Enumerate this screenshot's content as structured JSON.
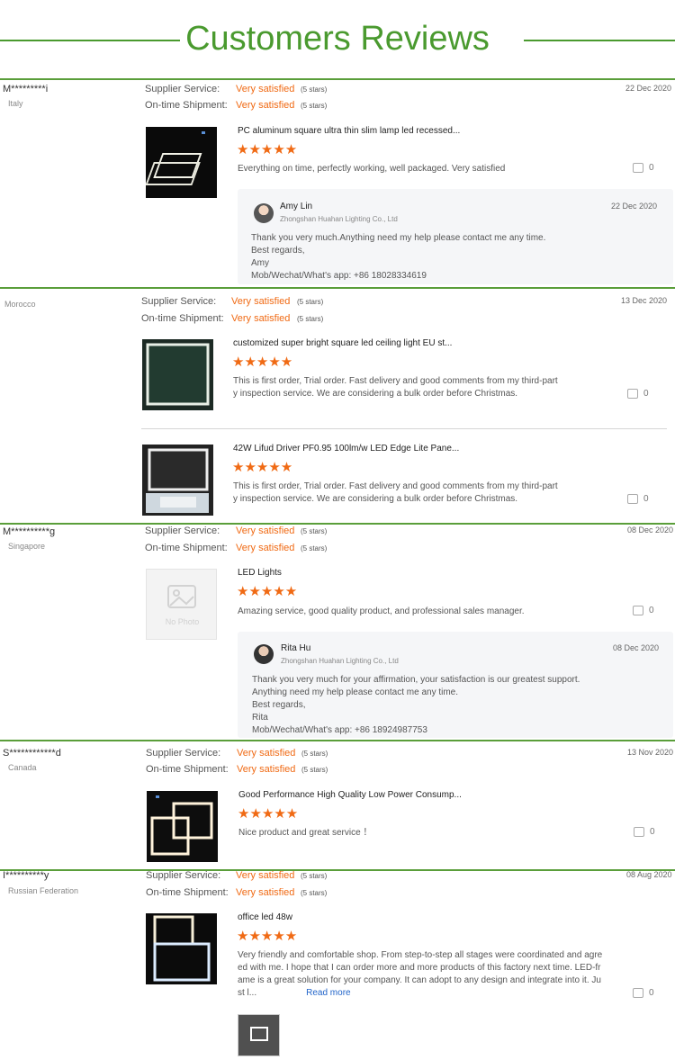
{
  "header": {
    "title": "Customers Reviews"
  },
  "labels": {
    "supplier": "Supplier Service:",
    "shipment": "On-time Shipment:"
  },
  "reviews": [
    {
      "name": "M*********i",
      "country": "Italy",
      "supplier_value": "Very satisfied",
      "supplier_stars": "(5 stars)",
      "shipment_value": "Very satisfied",
      "shipment_stars": "(5 stars)",
      "date": "22 Dec 2020",
      "rating": 5,
      "items": [
        {
          "product": "PC aluminum square ultra thin slim lamp led recessed...",
          "stars": "★★★★★",
          "text": [
            "Everything on time, perfectly working, well packaged. Very satisfied"
          ],
          "likes": "0"
        }
      ],
      "reply": {
        "name": "Amy Lin",
        "company": "Zhongshan Huahan Lighting Co., Ltd",
        "date": "22 Dec 2020",
        "lines": [
          "Thank you very much.Anything need my help please contact me any time.",
          "Best regards,",
          "Amy",
          "Mob/Wechat/What's app: +86 18028334619"
        ]
      }
    },
    {
      "name": "",
      "country": "Morocco",
      "supplier_value": "Very satisfied",
      "supplier_stars": "(5 stars)",
      "shipment_value": "Very satisfied",
      "shipment_stars": "(5 stars)",
      "date": "13 Dec 2020",
      "rating": 5,
      "items": [
        {
          "product": "customized super bright square led ceiling light EU st...",
          "stars": "★★★★★",
          "text": [
            "This is first order, Trial order. Fast delivery and good comments from my third-part",
            "y inspection service. We are considering a bulk order before Christmas."
          ],
          "likes": "0"
        },
        {
          "product": "42W Lifud Driver PF0.95 100lm/w LED Edge Lite Pane...",
          "stars": "★★★★★",
          "text": [
            "This is first order, Trial order. Fast delivery and good comments from my third-part",
            "y inspection service. We are considering a bulk order before Christmas."
          ],
          "likes": "0"
        }
      ]
    },
    {
      "name": "M**********g",
      "country": "Singapore",
      "supplier_value": "Very satisfied",
      "supplier_stars": "(5 stars)",
      "shipment_value": "Very satisfied",
      "shipment_stars": "(5 stars)",
      "date": "08 Dec 2020",
      "rating": 5,
      "items": [
        {
          "product": "LED Lights",
          "stars": "★★★★★",
          "text": [
            "Amazing service, good quality product, and professional sales manager."
          ],
          "likes": "0",
          "no_photo": "No Photo"
        }
      ],
      "reply": {
        "name": "Rita Hu",
        "company": "Zhongshan Huahan Lighting Co., Ltd",
        "date": "08 Dec 2020",
        "lines": [
          "Thank you very much for your affirmation, your satisfaction is our greatest support.",
          "Anything need my help please contact me any time.",
          "Best regards,",
          "Rita",
          "Mob/Wechat/What's app: +86 18924987753"
        ]
      }
    },
    {
      "name": "S************d",
      "country": "Canada",
      "supplier_value": "Very satisfied",
      "supplier_stars": "(5 stars)",
      "shipment_value": "Very satisfied",
      "shipment_stars": "(5 stars)",
      "date": "13 Nov 2020",
      "rating": 5,
      "items": [
        {
          "product": "Good Performance High Quality Low Power Consump...",
          "stars": "★★★★★",
          "text": [
            "Nice product and great service ！"
          ],
          "likes": "0"
        }
      ]
    },
    {
      "name": "I**********y",
      "country": "Russian Federation",
      "supplier_value": "Very satisfied",
      "supplier_stars": "(5 stars)",
      "shipment_value": "Very satisfied",
      "shipment_stars": "(5 stars)",
      "date": "08 Aug 2020",
      "rating": 5,
      "items": [
        {
          "product": "office led 48w",
          "stars": "★★★★★",
          "text": [
            "Very friendly and comfortable shop. From step-to-step all stages were coordinated and agre",
            "ed with me. I hope that I can order more and more products of this factory next time. LED-fr",
            "ame is a great solution for your company. It can adopt to any design and integrate into it. Ju",
            "st l..."
          ],
          "likes": "0",
          "read_more": "Read more"
        }
      ]
    }
  ],
  "colors": {
    "accent_green": "#4a9a2f",
    "rating_orange": "#f06a14",
    "link_blue": "#1f63c9"
  }
}
